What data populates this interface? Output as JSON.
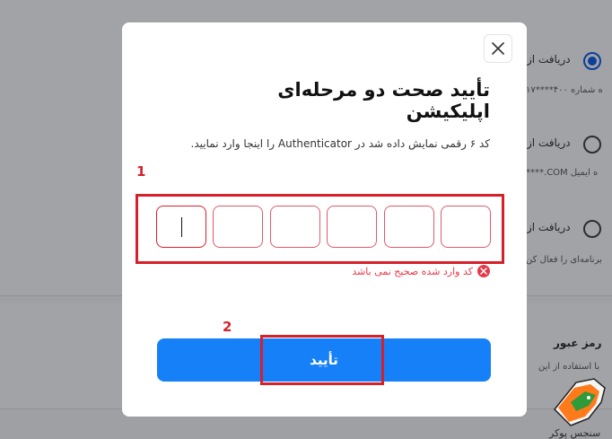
{
  "background": {
    "options": [
      {
        "label": "دریافت از",
        "subtext": "ه شماره ۴۰۰****۱۷",
        "checked": true
      },
      {
        "label": "دریافت از",
        "subtext": "ه ایمیل COM.****",
        "checked": false
      },
      {
        "label": "دریافت از",
        "subtext": "برنامه‌ای را فعال کن",
        "checked": false
      }
    ],
    "password_section": {
      "title": "رمز عبور",
      "subtext": "با استفاده از این"
    },
    "logo_text": "سنجس پوکر"
  },
  "modal": {
    "title": "تأیید صحت دو مرحله‌ای اپلیکیشن",
    "description": "کد ۶ رقمی نمایش داده شد در Authenticator را اینجا وارد نمایید.",
    "code_digits": [
      "",
      "",
      "",
      "",
      "",
      ""
    ],
    "error_text": "کد وارد شده صحیح نمی باشد",
    "confirm_label": "تأیید"
  },
  "annotations": {
    "step1": "1",
    "step2": "2"
  },
  "colors": {
    "accent": "#1680f8",
    "error": "#e6394a",
    "highlight": "#d6202a"
  }
}
